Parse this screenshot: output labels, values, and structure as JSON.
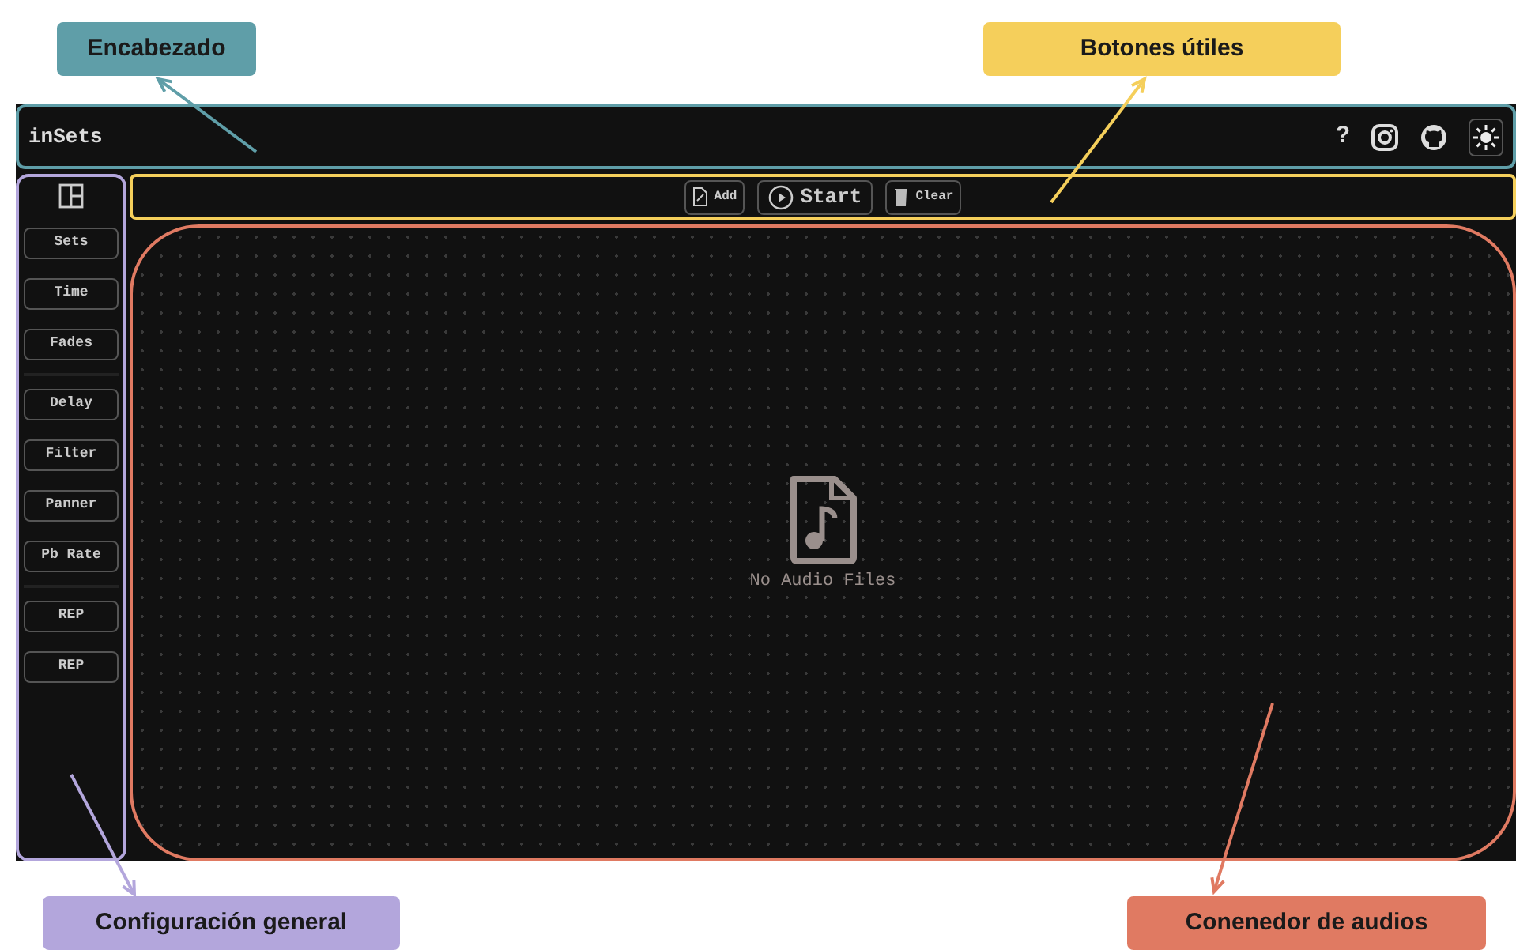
{
  "annotations": [
    {
      "kind": "header",
      "label": "Encabezado",
      "color": "#5f9ea8"
    },
    {
      "kind": "toolbar",
      "label": "Botones útiles",
      "color": "#f5cf5b"
    },
    {
      "kind": "sidebar",
      "label": "Configuración general",
      "color": "#b3a6dc"
    },
    {
      "kind": "container",
      "label": "Conenedor de audios",
      "color": "#e07a62"
    }
  ],
  "app": {
    "title": "inSets",
    "header_icons": [
      "?"
    ],
    "toolbar": [
      {
        "kind": "add",
        "label": "Add"
      },
      {
        "kind": "start",
        "label": "Start"
      },
      {
        "kind": "clear",
        "label": "Clear"
      }
    ],
    "sidebar_groups": [
      [
        "Sets",
        "Time",
        "Fades"
      ],
      [
        "Delay",
        "Filter",
        "Panner",
        "Pb Rate"
      ],
      [
        "REP",
        "REP"
      ]
    ],
    "empty_state": "No Audio Files"
  }
}
